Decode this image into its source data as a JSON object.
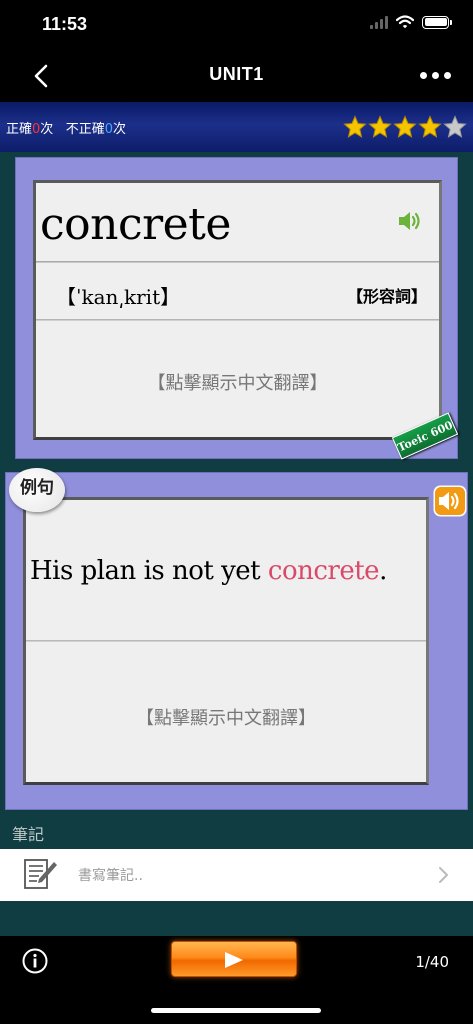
{
  "status": {
    "time": "11:53"
  },
  "nav": {
    "title": "UNIT1"
  },
  "score": {
    "correct_label": "正確",
    "correct_count": "0",
    "times1": "次",
    "incorrect_label": "不正確",
    "incorrect_count": "0",
    "times2": "次",
    "stars_filled": 4,
    "stars_total": 5
  },
  "word": {
    "text": "concrete",
    "phonetic": "【ˈkan͵krit】",
    "pos": "【形容詞】",
    "translate_hint": "【點擊顯示中文翻譯】",
    "tag": "Toeic 600"
  },
  "example": {
    "badge": "例句",
    "sentence_before": "His plan is not yet ",
    "sentence_highlight": "concrete",
    "sentence_after": ".",
    "translate_hint": "【點擊顯示中文翻譯】"
  },
  "notes": {
    "label": "筆記",
    "placeholder": "書寫筆記.."
  },
  "footer": {
    "page": "1/40"
  },
  "colors": {
    "card_border": "#8f8fdb",
    "content_bg": "#0f3d42",
    "star": "#f5c400",
    "highlight": "#d94a6a",
    "play": "#ff8a1a"
  }
}
